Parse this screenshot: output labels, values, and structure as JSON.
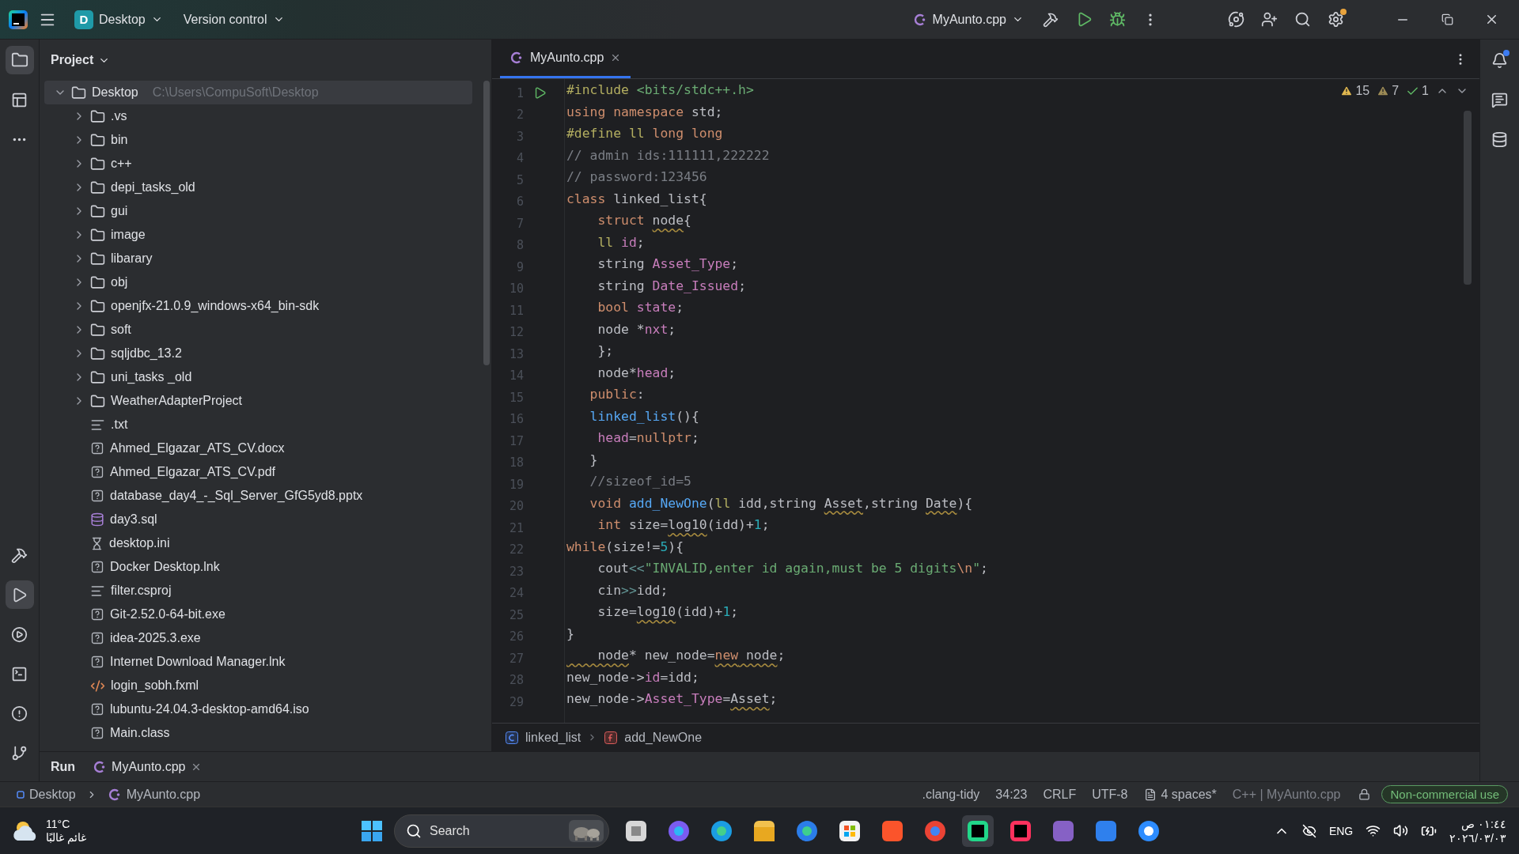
{
  "title_bar": {
    "project": {
      "badge": "D",
      "name": "Desktop"
    },
    "vcs": "Version control",
    "run_config": "MyAunto.cpp"
  },
  "project_panel": {
    "title": "Project",
    "tree": [
      {
        "name": "Desktop",
        "path": "C:\\Users\\CompuSoft\\Desktop",
        "kind": "folder",
        "expanded": true,
        "selected": true,
        "children": [
          {
            "name": ".vs",
            "kind": "folder",
            "expanded": false,
            "selected": false
          },
          {
            "name": "bin",
            "kind": "folder",
            "expanded": false,
            "selected": false
          },
          {
            "name": "c++",
            "kind": "folder",
            "expanded": false,
            "selected": false
          },
          {
            "name": "depi_tasks_old",
            "kind": "folder",
            "expanded": false,
            "selected": false
          },
          {
            "name": "gui",
            "kind": "folder",
            "expanded": false,
            "selected": false
          },
          {
            "name": "image",
            "kind": "folder",
            "expanded": false,
            "selected": false
          },
          {
            "name": "libarary",
            "kind": "folder",
            "expanded": false,
            "selected": false
          },
          {
            "name": "obj",
            "kind": "folder",
            "expanded": false,
            "selected": false
          },
          {
            "name": "openjfx-21.0.9_windows-x64_bin-sdk",
            "kind": "folder",
            "expanded": false,
            "selected": false
          },
          {
            "name": "soft",
            "kind": "folder",
            "expanded": false,
            "selected": false
          },
          {
            "name": "sqljdbc_13.2",
            "kind": "folder",
            "expanded": false,
            "selected": false
          },
          {
            "name": "uni_tasks _old",
            "kind": "folder",
            "expanded": false,
            "selected": false
          },
          {
            "name": "WeatherAdapterProject",
            "kind": "folder",
            "expanded": false,
            "selected": false
          },
          {
            "name": ".txt",
            "kind": "text",
            "selected": false
          },
          {
            "name": "Ahmed_Elgazar_ATS_CV.docx",
            "kind": "unknown",
            "selected": false
          },
          {
            "name": "Ahmed_Elgazar_ATS_CV.pdf",
            "kind": "unknown",
            "selected": false
          },
          {
            "name": "database_day4_-_Sql_Server_GfG5yd8.pptx",
            "kind": "unknown",
            "selected": false
          },
          {
            "name": "day3.sql",
            "kind": "database",
            "selected": false
          },
          {
            "name": "desktop.ini",
            "kind": "config",
            "selected": false
          },
          {
            "name": "Docker Desktop.lnk",
            "kind": "unknown",
            "selected": false
          },
          {
            "name": "filter.csproj",
            "kind": "text",
            "selected": false
          },
          {
            "name": "Git-2.52.0-64-bit.exe",
            "kind": "unknown",
            "selected": false
          },
          {
            "name": "idea-2025.3.exe",
            "kind": "unknown",
            "selected": false
          },
          {
            "name": "Internet Download Manager.lnk",
            "kind": "unknown",
            "selected": false
          },
          {
            "name": "login_sobh.fxml",
            "kind": "markup",
            "selected": false
          },
          {
            "name": "lubuntu-24.04.3-desktop-amd64.iso",
            "kind": "unknown",
            "selected": false
          },
          {
            "name": "Main.class",
            "kind": "unknown",
            "selected": false
          }
        ]
      }
    ]
  },
  "editor": {
    "tabs": [
      {
        "label": "MyAunto.cpp",
        "selected": true
      }
    ],
    "inspections": [
      {
        "kind": "warning",
        "count": "15"
      },
      {
        "kind": "weak",
        "count": "7"
      },
      {
        "kind": "typo",
        "count": "1"
      }
    ],
    "lines": [
      {
        "number": "1",
        "run": true,
        "tokens": [
          {
            "text": "#include",
            "kind": "preproc"
          },
          {
            "text": " <bits/stdc++.h>",
            "kind": "string"
          }
        ]
      },
      {
        "number": "2",
        "tokens": [
          {
            "text": "using",
            "kind": "keyword"
          },
          {
            "text": " namespace",
            "kind": "keyword"
          },
          {
            "text": " std;",
            "kind": "plain"
          }
        ]
      },
      {
        "number": "3",
        "tokens": [
          {
            "text": "#define",
            "kind": "preproc"
          },
          {
            "text": " ll",
            "kind": "macro"
          },
          {
            "text": " long long",
            "kind": "keyword"
          }
        ]
      },
      {
        "number": "4",
        "tokens": [
          {
            "text": "// admin ids:111111,222222",
            "kind": "comment"
          }
        ]
      },
      {
        "number": "5",
        "tokens": [
          {
            "text": "// password:123456",
            "kind": "comment"
          }
        ]
      },
      {
        "number": "6",
        "tokens": [
          {
            "text": "class",
            "kind": "keyword"
          },
          {
            "text": " linked_list{",
            "kind": "plain"
          }
        ]
      },
      {
        "number": "7",
        "tokens": [
          {
            "text": "    struct ",
            "kind": "keyword"
          },
          {
            "text": "node",
            "kind": "plain",
            "warning": true
          },
          {
            "text": "{",
            "kind": "plain"
          }
        ]
      },
      {
        "number": "8",
        "tokens": [
          {
            "text": "    ll",
            "kind": "macro"
          },
          {
            "text": " id",
            "kind": "field"
          },
          {
            "text": ";",
            "kind": "plain"
          }
        ]
      },
      {
        "number": "9",
        "tokens": [
          {
            "text": "    string ",
            "kind": "plain"
          },
          {
            "text": "Asset_Type",
            "kind": "field"
          },
          {
            "text": ";",
            "kind": "plain"
          }
        ]
      },
      {
        "number": "10",
        "tokens": [
          {
            "text": "    string ",
            "kind": "plain"
          },
          {
            "text": "Date_Issued",
            "kind": "field"
          },
          {
            "text": ";",
            "kind": "plain"
          }
        ]
      },
      {
        "number": "11",
        "tokens": [
          {
            "text": "    bool",
            "kind": "keyword"
          },
          {
            "text": " state",
            "kind": "field"
          },
          {
            "text": ";",
            "kind": "plain"
          }
        ]
      },
      {
        "number": "12",
        "tokens": [
          {
            "text": "    node *",
            "kind": "plain"
          },
          {
            "text": "nxt",
            "kind": "field"
          },
          {
            "text": ";",
            "kind": "plain"
          }
        ]
      },
      {
        "number": "13",
        "tokens": [
          {
            "text": "    };",
            "kind": "plain"
          }
        ]
      },
      {
        "number": "14",
        "tokens": [
          {
            "text": "    node*",
            "kind": "plain"
          },
          {
            "text": "head",
            "kind": "field"
          },
          {
            "text": ";",
            "kind": "plain"
          }
        ]
      },
      {
        "number": "15",
        "tokens": [
          {
            "text": "   public",
            "kind": "keyword"
          },
          {
            "text": ":",
            "kind": "plain"
          }
        ]
      },
      {
        "number": "16",
        "tokens": [
          {
            "text": "   linked_list",
            "kind": "function"
          },
          {
            "text": "(){",
            "kind": "plain"
          }
        ]
      },
      {
        "number": "17",
        "tokens": [
          {
            "text": "    head",
            "kind": "field"
          },
          {
            "text": "=",
            "kind": "plain"
          },
          {
            "text": "nullptr",
            "kind": "keyword"
          },
          {
            "text": ";",
            "kind": "plain"
          }
        ]
      },
      {
        "number": "18",
        "tokens": [
          {
            "text": "   }",
            "kind": "plain"
          }
        ]
      },
      {
        "number": "19",
        "tokens": [
          {
            "text": "   //sizeof_id=5",
            "kind": "comment"
          }
        ]
      },
      {
        "number": "20",
        "tokens": [
          {
            "text": "   void",
            "kind": "keyword"
          },
          {
            "text": " add_NewOne",
            "kind": "function"
          },
          {
            "text": "(",
            "kind": "plain"
          },
          {
            "text": "ll",
            "kind": "macro"
          },
          {
            "text": " idd,string ",
            "kind": "plain"
          },
          {
            "text": "Asset",
            "kind": "plain",
            "warning": true
          },
          {
            "text": ",string ",
            "kind": "plain"
          },
          {
            "text": "Date",
            "kind": "plain",
            "warning": true
          },
          {
            "text": "){",
            "kind": "plain"
          }
        ]
      },
      {
        "number": "21",
        "tokens": [
          {
            "text": "    int",
            "kind": "keyword"
          },
          {
            "text": " size=",
            "kind": "plain"
          },
          {
            "text": "log10",
            "kind": "plain",
            "warning": true
          },
          {
            "text": "(idd)+",
            "kind": "plain"
          },
          {
            "text": "1",
            "kind": "number"
          },
          {
            "text": ";",
            "kind": "plain"
          }
        ]
      },
      {
        "number": "22",
        "tokens": [
          {
            "text": "while",
            "kind": "keyword"
          },
          {
            "text": "(size!=",
            "kind": "plain"
          },
          {
            "text": "5",
            "kind": "number"
          },
          {
            "text": "){",
            "kind": "plain"
          }
        ]
      },
      {
        "number": "23",
        "tokens": [
          {
            "text": "    cout",
            "kind": "plain"
          },
          {
            "text": "<<",
            "kind": "operator"
          },
          {
            "text": "\"INVALID,enter id again,must be 5 digits",
            "kind": "string"
          },
          {
            "text": "\\n",
            "kind": "escape"
          },
          {
            "text": "\"",
            "kind": "string"
          },
          {
            "text": ";",
            "kind": "plain"
          }
        ]
      },
      {
        "number": "24",
        "tokens": [
          {
            "text": "    cin",
            "kind": "plain"
          },
          {
            "text": ">>",
            "kind": "operator"
          },
          {
            "text": "idd;",
            "kind": "plain"
          }
        ]
      },
      {
        "number": "25",
        "tokens": [
          {
            "text": "    size=",
            "kind": "plain"
          },
          {
            "text": "log10",
            "kind": "plain",
            "warning": true
          },
          {
            "text": "(idd)+",
            "kind": "plain"
          },
          {
            "text": "1",
            "kind": "number"
          },
          {
            "text": ";",
            "kind": "plain"
          }
        ]
      },
      {
        "number": "26",
        "tokens": [
          {
            "text": "}",
            "kind": "plain"
          }
        ]
      },
      {
        "number": "27",
        "tokens": [
          {
            "text": "    node",
            "kind": "plain",
            "warning": true
          },
          {
            "text": "* new_node=",
            "kind": "plain"
          },
          {
            "text": "new",
            "kind": "keyword",
            "warning": true
          },
          {
            "text": " node",
            "kind": "plain",
            "warning": true
          },
          {
            "text": ";",
            "kind": "plain"
          }
        ]
      },
      {
        "number": "28",
        "tokens": [
          {
            "text": "new_node->",
            "kind": "plain"
          },
          {
            "text": "id",
            "kind": "field"
          },
          {
            "text": "=idd;",
            "kind": "plain"
          }
        ]
      },
      {
        "number": "29",
        "tokens": [
          {
            "text": "new_node->",
            "kind": "plain"
          },
          {
            "text": "Asset_Type",
            "kind": "field"
          },
          {
            "text": "=",
            "kind": "plain"
          },
          {
            "text": "Asset",
            "kind": "plain",
            "warning": true
          },
          {
            "text": ";",
            "kind": "plain"
          }
        ]
      }
    ],
    "breadcrumbs": [
      {
        "label": "linked_list",
        "kind": "class"
      },
      {
        "label": "add_NewOne",
        "kind": "function"
      }
    ]
  },
  "run_panel": {
    "title": "Run",
    "tabs": [
      {
        "label": "MyAunto.cpp",
        "selected": true
      }
    ]
  },
  "status_bar": {
    "path": [
      "Desktop",
      "MyAunto.cpp"
    ],
    "items": [
      {
        "text": ".clang-tidy",
        "kind": "plain"
      },
      {
        "text": "34:23",
        "kind": "plain"
      },
      {
        "text": "CRLF",
        "kind": "plain"
      },
      {
        "text": "UTF-8",
        "kind": "plain"
      },
      {
        "text": "4 spaces*",
        "kind": "indent"
      },
      {
        "text": "C++ | MyAunto.cpp",
        "kind": "plain"
      }
    ],
    "license": "Non-commercial use"
  },
  "taskbar": {
    "weather": {
      "temp": "11°C",
      "text": "غائم غالبًا"
    },
    "search": "Search",
    "language": "ENG",
    "time": "٠١:٤٤ ص",
    "date": "٢٠٢٦/٠٣/٠٣"
  }
}
